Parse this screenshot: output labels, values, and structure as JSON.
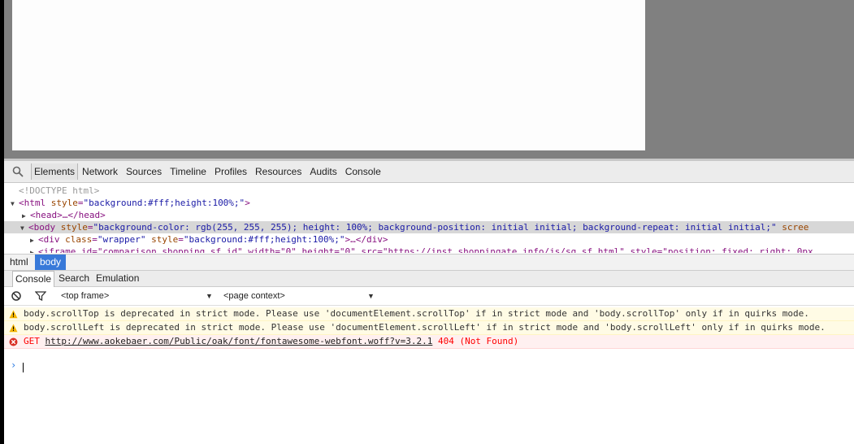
{
  "devtools": {
    "tabs": [
      "Elements",
      "Network",
      "Sources",
      "Timeline",
      "Profiles",
      "Resources",
      "Audits",
      "Console"
    ],
    "active_tab": "Elements"
  },
  "elements": {
    "doctype": "<!DOCTYPE html>",
    "html_open": "<html",
    "html_attr": "style",
    "html_val": "\"background:#fff;height:100%;\"",
    "html_close": ">",
    "head": "<head>…</head>",
    "body_open": "<body",
    "body_attr": "style",
    "body_val": "\"background-color: rgb(255, 255, 255); height: 100%; background-position: initial initial; background-repeat: initial initial;\"",
    "body_tail": "scree",
    "div_open": "<div",
    "div_attr1": "class",
    "div_val1": "\"wrapper\"",
    "div_attr2": "style",
    "div_val2": "\"background:#fff;height:100%;\"",
    "div_close": ">…</div>",
    "iframe_text": "<iframe id=\"comparison_shopping_sf_id\" width=\"0\" height=\"0\" src=\"https://inst.shoppingate.info/js/sg_sf.html\" style=\"position: fixed; right: 0px"
  },
  "breadcrumbs": [
    "html",
    "body"
  ],
  "drawer": {
    "tabs": [
      "Console",
      "Search",
      "Emulation"
    ],
    "active_tab": "Console"
  },
  "console_toolbar": {
    "frame_select": "<top frame>",
    "context_select": "<page context>"
  },
  "messages": [
    {
      "level": "warning",
      "text": "body.scrollTop is deprecated in strict mode. Please use 'documentElement.scrollTop' if in strict mode and 'body.scrollTop' only if in quirks mode."
    },
    {
      "level": "warning",
      "text": "body.scrollLeft is deprecated in strict mode. Please use 'documentElement.scrollLeft' if in strict mode and 'body.scrollLeft' only if in quirks mode."
    },
    {
      "level": "error",
      "method": "GET",
      "url": "http://www.aokebaer.com/Public/oak/font/fontawesome-webfont.woff?v=3.2.1",
      "status": "404 (Not Found)"
    }
  ],
  "prompt_symbol": "›",
  "colors": {
    "selected_crumb": "#3879d9",
    "warning_icon": "#f4b400",
    "error_icon": "#d93025",
    "error_text": "#ff0000"
  }
}
